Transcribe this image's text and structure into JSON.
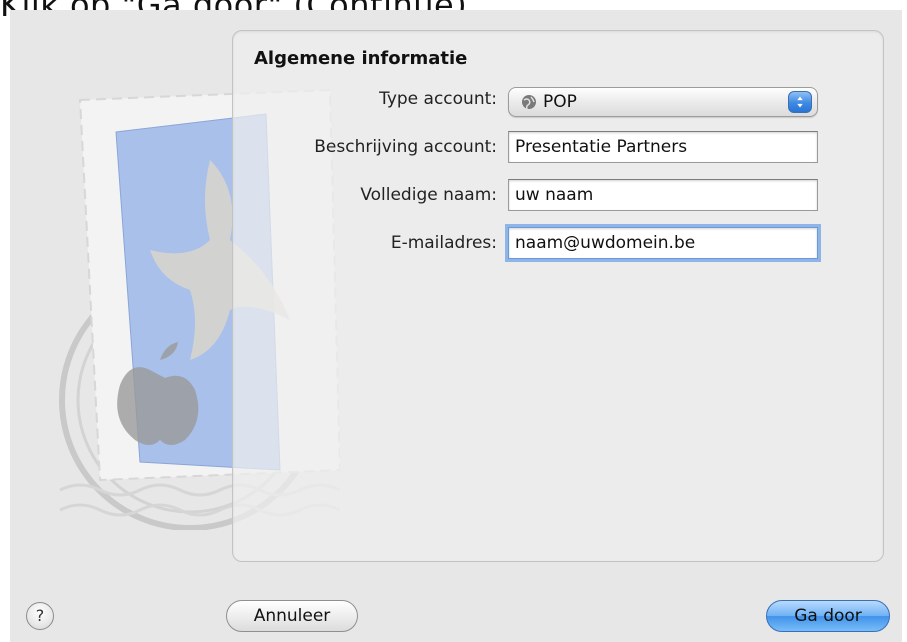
{
  "caption": "Klik op \"Ga door\" (Continue).",
  "section_title": "Algemene informatie",
  "account_type": {
    "label": "Type account:",
    "selected": "POP",
    "icon": "globe-icon"
  },
  "description": {
    "label": "Beschrijving account:",
    "value": "Presentatie Partners"
  },
  "full_name": {
    "label": "Volledige naam:",
    "value": "uw naam"
  },
  "email": {
    "label": "E-mailadres:",
    "value": "naam@uwdomein.be"
  },
  "buttons": {
    "help": "?",
    "cancel": "Annuleer",
    "continue": "Ga door"
  },
  "colors": {
    "accent": "#3f92ea",
    "focus_ring": "#8fb5e8"
  }
}
